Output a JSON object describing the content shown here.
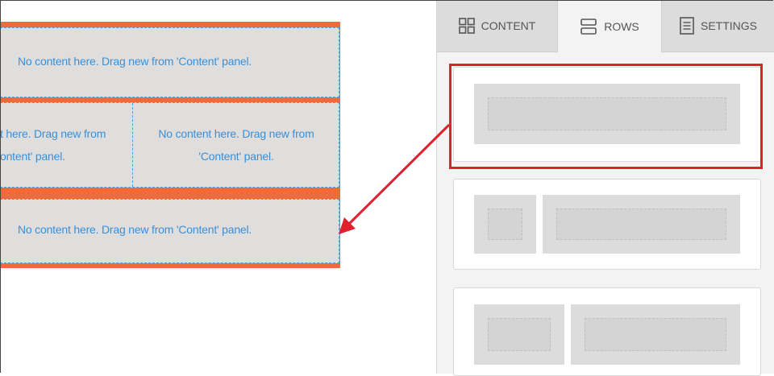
{
  "canvas": {
    "placeholder_full": "No content here. Drag new from 'Content' panel.",
    "placeholder_left_line1": "t here. Drag new from",
    "placeholder_left_line2": "ontent' panel.",
    "placeholder_right_line1": "No content here. Drag new from",
    "placeholder_right_line2": "'Content' panel."
  },
  "panel": {
    "tabs": [
      {
        "label": "CONTENT",
        "icon": "grid-icon"
      },
      {
        "label": "ROWS",
        "icon": "rows-icon",
        "active": true
      },
      {
        "label": "SETTINGS",
        "icon": "document-icon"
      }
    ]
  },
  "colors": {
    "accent_orange": "#ef6b3b",
    "placeholder_blue": "#3b8fd6",
    "highlight_red": "#e0202c"
  }
}
